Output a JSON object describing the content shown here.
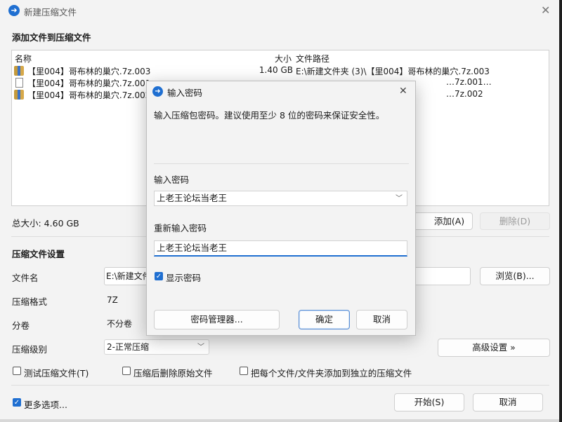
{
  "window": {
    "title": "新建压缩文件",
    "app_icon": "app-logo-icon"
  },
  "header": {
    "add_files_title": "添加文件到压缩文件"
  },
  "file_list": {
    "columns": {
      "name": "名称",
      "size": "大小",
      "path": "文件路径"
    },
    "rows": [
      {
        "icon": "archive-icon",
        "name": "【里004】哥布林的巢穴.7z.003",
        "size": "1.40 GB",
        "path": "E:\\新建文件夹 (3)\\【里004】哥布林的巢穴.7z.003"
      },
      {
        "icon": "file-icon",
        "name": "【里004】哥布林的巢穴.7z.001",
        "size": "",
        "path": "…7z.001…"
      },
      {
        "icon": "archive-icon",
        "name": "【里004】哥布林的巢穴.7z.002",
        "size": "",
        "path": "…7z.002"
      }
    ]
  },
  "total_size": "总大小: 4.60 GB",
  "buttons": {
    "add": "添加(A)",
    "remove": "删除(D)",
    "browse": "浏览(B)...",
    "advanced": "高级设置 »",
    "start": "开始(S)",
    "cancel": "取消"
  },
  "settings": {
    "title": "压缩文件设置",
    "filename_label": "文件名",
    "filename_value": "E:\\新建文件",
    "format_label": "压缩格式",
    "format_value": "7Z",
    "split_label": "分卷",
    "split_value": "不分卷",
    "level_label": "压缩级别",
    "level_value": "2-正常压缩"
  },
  "options": {
    "test": "测试压缩文件(T)",
    "delete_original": "压缩后删除原始文件",
    "separate": "把每个文件/文件夹添加到独立的压缩文件",
    "more": "更多选项..."
  },
  "dialog": {
    "title": "输入密码",
    "description": "输入压缩包密码。建议使用至少 8 位的密码来保证安全性。",
    "password_label": "输入密码",
    "password_value": "上老王论坛当老王",
    "reenter_label": "重新输入密码",
    "reenter_value": "上老王论坛当老王",
    "show_password": "显示密码",
    "manager_button": "密码管理器...",
    "ok_button": "确定",
    "cancel_button": "取消"
  },
  "colors": {
    "accent": "#1f6fd1",
    "window_bg": "#f3f3f3"
  }
}
